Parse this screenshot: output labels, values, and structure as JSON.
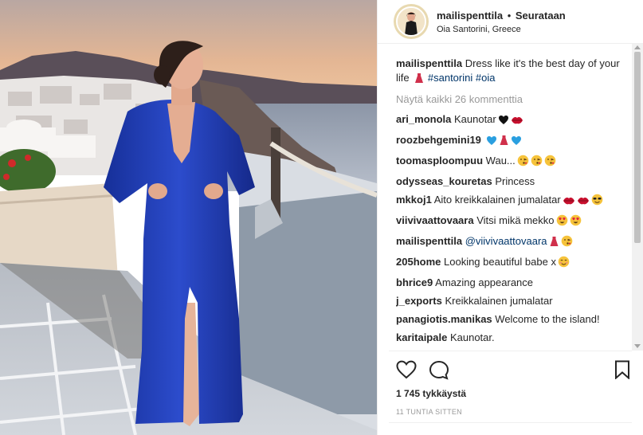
{
  "post": {
    "username": "mailispenttila",
    "separator": "•",
    "follow_status": "Seurataan",
    "location": "Oia Santorini, Greece",
    "caption_text": "Dress like it's the best day of your life",
    "caption_emoji": "red-dress-emoji",
    "caption_tags": [
      "#santorini",
      "#oia"
    ],
    "view_all": "Näytä kaikki 26 kommenttia",
    "likes": "1 745 tykkäystä",
    "time": "11 TUNTIA SITTEN"
  },
  "comments": [
    {
      "user": "ari_monola",
      "text": "Kaunotar",
      "emojis": [
        "black-heart",
        "kiss-lips"
      ]
    },
    {
      "user": "roozbehgemini19",
      "text": "",
      "emojis": [
        "blue-heart",
        "red-dress",
        "blue-heart"
      ]
    },
    {
      "user": "toomasploompuu",
      "text": "Wau...",
      "emojis": [
        "face-kiss",
        "face-kiss",
        "face-kiss"
      ]
    },
    {
      "user": "odysseas_kouretas",
      "text": "Princess",
      "emojis": []
    },
    {
      "user": "mkkoj1",
      "text": "Aito kreikkalainen jumalatar",
      "emojis": [
        "kiss-lips",
        "kiss-lips",
        "cool-face"
      ]
    },
    {
      "user": "viivivaattovaara",
      "text": "Vitsi mikä mekko",
      "emojis": [
        "heart-eyes",
        "heart-eyes"
      ]
    },
    {
      "user": "mailispenttila",
      "text": "",
      "mention": "@viivivaattovaara",
      "emojis": [
        "red-dress",
        "face-kiss"
      ]
    },
    {
      "user": "205home",
      "text": "Looking beautiful babe x",
      "emojis": [
        "blush-face"
      ]
    },
    {
      "user": "bhrice9",
      "text": "Amazing appearance",
      "emojis": []
    },
    {
      "user": "j_exports",
      "text": "Kreikkalainen jumalatar",
      "emojis": []
    },
    {
      "user": "panagiotis.manikas",
      "text": "Welcome to the island!",
      "emojis": []
    },
    {
      "user": "karitaipale",
      "text": "Kaunotar.",
      "emojis": []
    }
  ],
  "icons": {
    "like": "heart-outline-icon",
    "comment": "comment-bubble-icon",
    "save": "bookmark-icon"
  },
  "colors": {
    "dress": "#1f3db0",
    "link": "#003569",
    "muted": "#999999",
    "sky_top": "#d9a983",
    "sea": "#7a8fa8"
  }
}
